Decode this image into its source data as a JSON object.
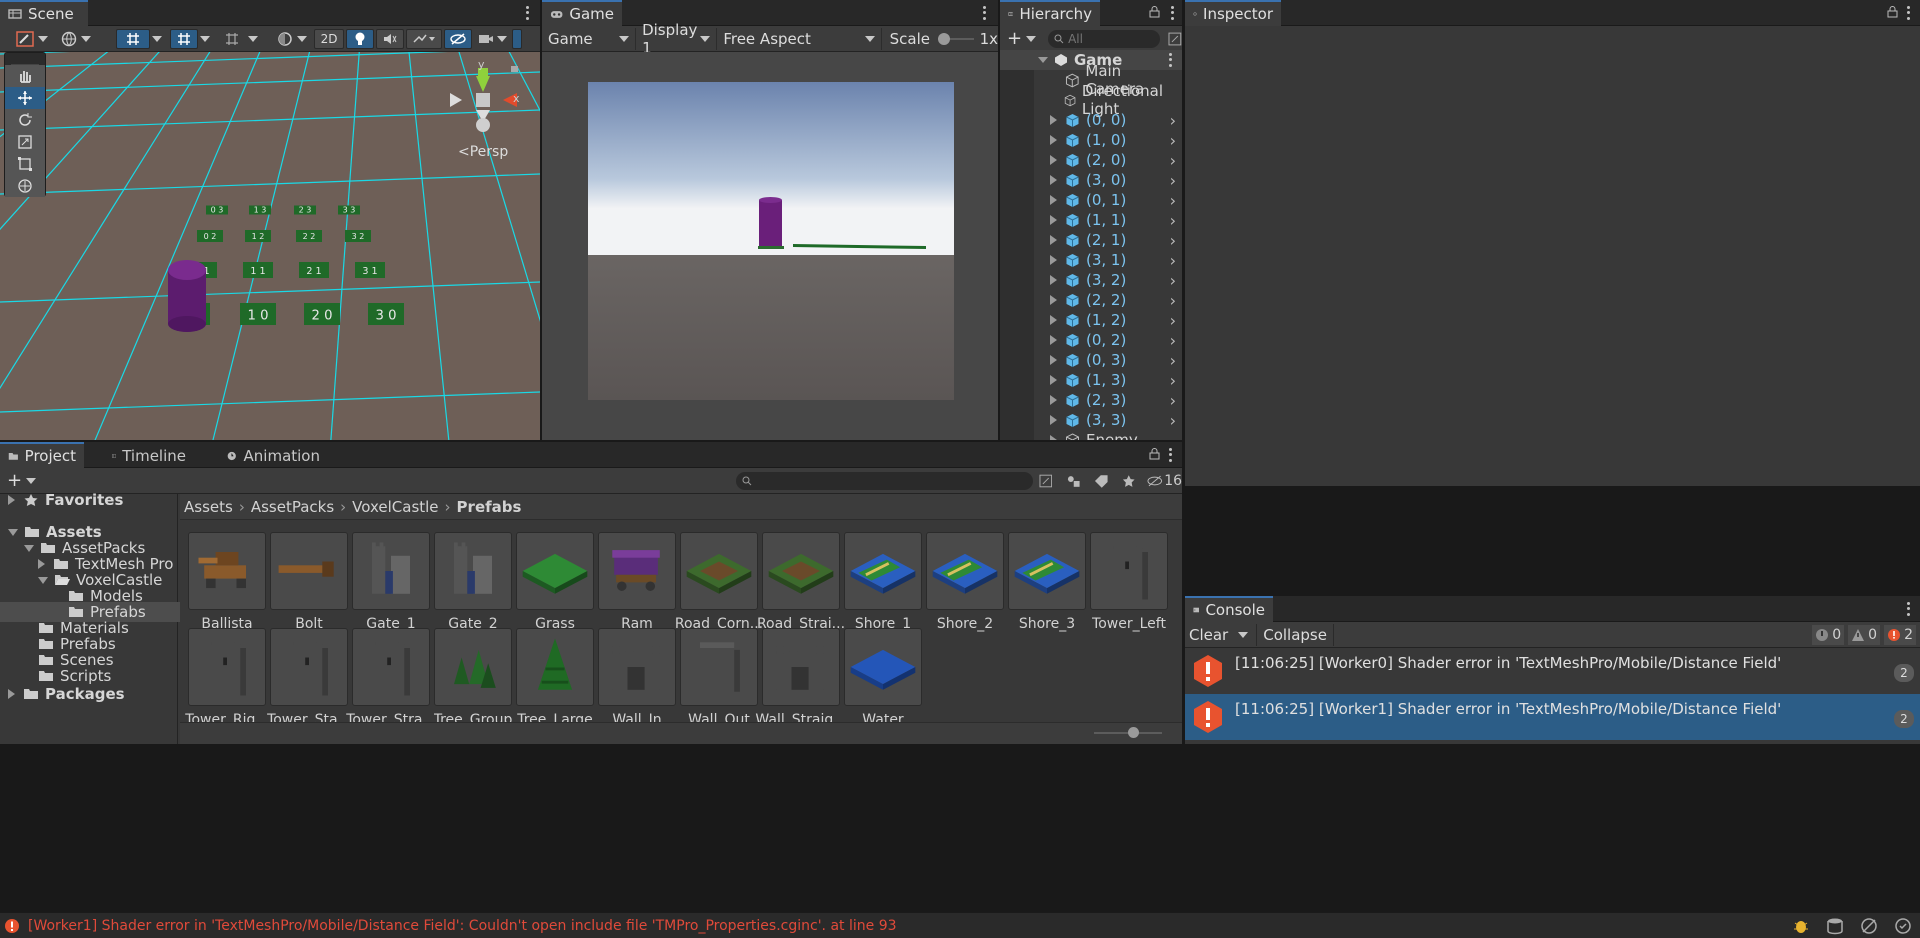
{
  "scene": {
    "tab": "Scene",
    "toolbar": {
      "mode_2d": "2D"
    },
    "persp_label": "<Persp",
    "axis_y": "y",
    "axis_x": "x",
    "tile_labels": [
      "0 3",
      "1 3",
      "2 3",
      "3 3",
      "0 2",
      "1 2",
      "2 2",
      "3 2",
      "0 1",
      "1 1",
      "2 1",
      "3 1",
      "0, 0",
      "1 0",
      "2 0",
      "3 0"
    ]
  },
  "game": {
    "tab": "Game",
    "display_dropdown": "Game",
    "display_number": "Display 1",
    "aspect": "Free Aspect",
    "scale_label": "Scale",
    "scale_value": "1x"
  },
  "hierarchy": {
    "tab": "Hierarchy",
    "add_label": "+",
    "search_placeholder": "All",
    "root": "Game",
    "items": [
      {
        "label": "Main Camera",
        "type": "object",
        "expandable": false
      },
      {
        "label": "Directional Light",
        "type": "object",
        "expandable": false
      },
      {
        "label": "(0, 0)",
        "type": "prefab",
        "expandable": true
      },
      {
        "label": "(1, 0)",
        "type": "prefab",
        "expandable": true
      },
      {
        "label": "(2, 0)",
        "type": "prefab",
        "expandable": true
      },
      {
        "label": "(3, 0)",
        "type": "prefab",
        "expandable": true
      },
      {
        "label": "(0, 1)",
        "type": "prefab",
        "expandable": true
      },
      {
        "label": "(1, 1)",
        "type": "prefab",
        "expandable": true
      },
      {
        "label": "(2, 1)",
        "type": "prefab",
        "expandable": true
      },
      {
        "label": "(3, 1)",
        "type": "prefab",
        "expandable": true
      },
      {
        "label": "(3, 2)",
        "type": "prefab",
        "expandable": true
      },
      {
        "label": "(2, 2)",
        "type": "prefab",
        "expandable": true
      },
      {
        "label": "(1, 2)",
        "type": "prefab",
        "expandable": true
      },
      {
        "label": "(0, 2)",
        "type": "prefab",
        "expandable": true
      },
      {
        "label": "(0, 3)",
        "type": "prefab",
        "expandable": true
      },
      {
        "label": "(1, 3)",
        "type": "prefab",
        "expandable": true
      },
      {
        "label": "(2, 3)",
        "type": "prefab",
        "expandable": true
      },
      {
        "label": "(3, 3)",
        "type": "prefab",
        "expandable": true
      },
      {
        "label": "Enemy",
        "type": "object",
        "expandable": true
      }
    ]
  },
  "inspector": {
    "tab": "Inspector"
  },
  "project": {
    "tabs": [
      "Project",
      "Timeline",
      "Animation"
    ],
    "add_label": "+",
    "hidden_count": "16",
    "tree": [
      {
        "label": "Favorites",
        "type": "star"
      },
      {
        "label": "Assets",
        "type": "folder"
      },
      {
        "label": "AssetPacks",
        "type": "folder"
      },
      {
        "label": "TextMesh Pro",
        "type": "folder"
      },
      {
        "label": "VoxelCastle",
        "type": "folder-open"
      },
      {
        "label": "Models",
        "type": "folder"
      },
      {
        "label": "Prefabs",
        "type": "folder"
      },
      {
        "label": "Materials",
        "type": "folder"
      },
      {
        "label": "Prefabs",
        "type": "folder"
      },
      {
        "label": "Scenes",
        "type": "folder"
      },
      {
        "label": "Scripts",
        "type": "folder"
      },
      {
        "label": "Packages",
        "type": "folder"
      }
    ],
    "breadcrumb": [
      "Assets",
      "AssetPacks",
      "VoxelCastle",
      "Prefabs"
    ],
    "assets": [
      {
        "label": "Ballista",
        "icon": "ballista"
      },
      {
        "label": "Bolt",
        "icon": "bolt"
      },
      {
        "label": "Gate_1",
        "icon": "gate"
      },
      {
        "label": "Gate_2",
        "icon": "gate"
      },
      {
        "label": "Grass",
        "icon": "grass"
      },
      {
        "label": "Ram",
        "icon": "ram"
      },
      {
        "label": "Road_Corn...",
        "icon": "road"
      },
      {
        "label": "Road_Strai...",
        "icon": "road"
      },
      {
        "label": "Shore_1",
        "icon": "shore"
      },
      {
        "label": "Shore_2",
        "icon": "shore"
      },
      {
        "label": "Shore_3",
        "icon": "shore"
      },
      {
        "label": "Tower_Left",
        "icon": "tower"
      },
      {
        "label": "Tower_Rig...",
        "icon": "tower"
      },
      {
        "label": "Tower_Sta...",
        "icon": "tower"
      },
      {
        "label": "Tower_Stra...",
        "icon": "tower"
      },
      {
        "label": "Tree_Group",
        "icon": "treegroup"
      },
      {
        "label": "Tree_Large",
        "icon": "treelarge"
      },
      {
        "label": "Wall_In",
        "icon": "wall"
      },
      {
        "label": "Wall_Out",
        "icon": "wallout"
      },
      {
        "label": "Wall_Straig...",
        "icon": "wall"
      },
      {
        "label": "Water",
        "icon": "water"
      }
    ]
  },
  "console": {
    "tab": "Console",
    "clear": "Clear",
    "collapse": "Collapse",
    "info_count": "0",
    "warn_count": "0",
    "error_count": "2",
    "entries": [
      {
        "text": "[11:06:25] [Worker0] Shader error in 'TextMeshPro/Mobile/Distance Field'",
        "count": "2"
      },
      {
        "text": "[11:06:25] [Worker1] Shader error in 'TextMeshPro/Mobile/Distance Field'",
        "count": "2"
      }
    ]
  },
  "status_bar": {
    "message": "[Worker1] Shader error in 'TextMeshPro/Mobile/Distance Field': Couldn't open include file 'TMPro_Properties.cginc'. at line 93"
  },
  "colors": {
    "accent": "#3a72b0",
    "selection": "#2c5d87",
    "error": "#e8532f",
    "status_error_text": "#e04a3a",
    "grid_line": "#19d9e6",
    "ground": "#6e5f57",
    "enemy": "#6a1f7a",
    "tile": "#1f6a28"
  }
}
